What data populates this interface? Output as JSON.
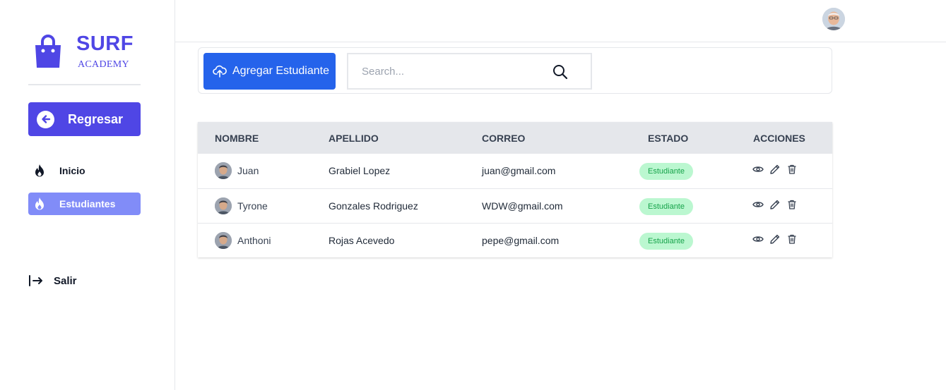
{
  "brand": {
    "title": "SURF",
    "subtitle": "ACADEMY",
    "color": "#4f46e5"
  },
  "sidebar": {
    "back_label": "Regresar",
    "items": [
      {
        "label": "Inicio",
        "icon": "fire-icon",
        "active": false
      },
      {
        "label": "Estudiantes",
        "icon": "fire-icon",
        "active": true
      }
    ],
    "logout_label": "Salir"
  },
  "toolbar": {
    "add_label": "Agregar Estudiante",
    "search_placeholder": "Search..."
  },
  "table": {
    "headers": [
      "NOMBRE",
      "APELLIDO",
      "CORREO",
      "ESTADO",
      "ACCIONES"
    ],
    "rows": [
      {
        "nombre": "Juan",
        "apellido": "Grabiel Lopez",
        "correo": "juan@gmail.com",
        "estado": "Estudiante"
      },
      {
        "nombre": "Tyrone",
        "apellido": "Gonzales Rodriguez",
        "correo": "WDW@gmail.com",
        "estado": "Estudiante"
      },
      {
        "nombre": "Anthoni",
        "apellido": "Rojas Acevedo",
        "correo": "pepe@gmail.com",
        "estado": "Estudiante"
      }
    ],
    "action_icons": [
      "eye-icon",
      "pencil-icon",
      "trash-icon"
    ]
  },
  "colors": {
    "primary": "#4f46e5",
    "button_blue": "#2563eb",
    "active_nav": "#818cf8",
    "badge_bg": "#bbf7d0",
    "badge_text": "#16a34a"
  }
}
